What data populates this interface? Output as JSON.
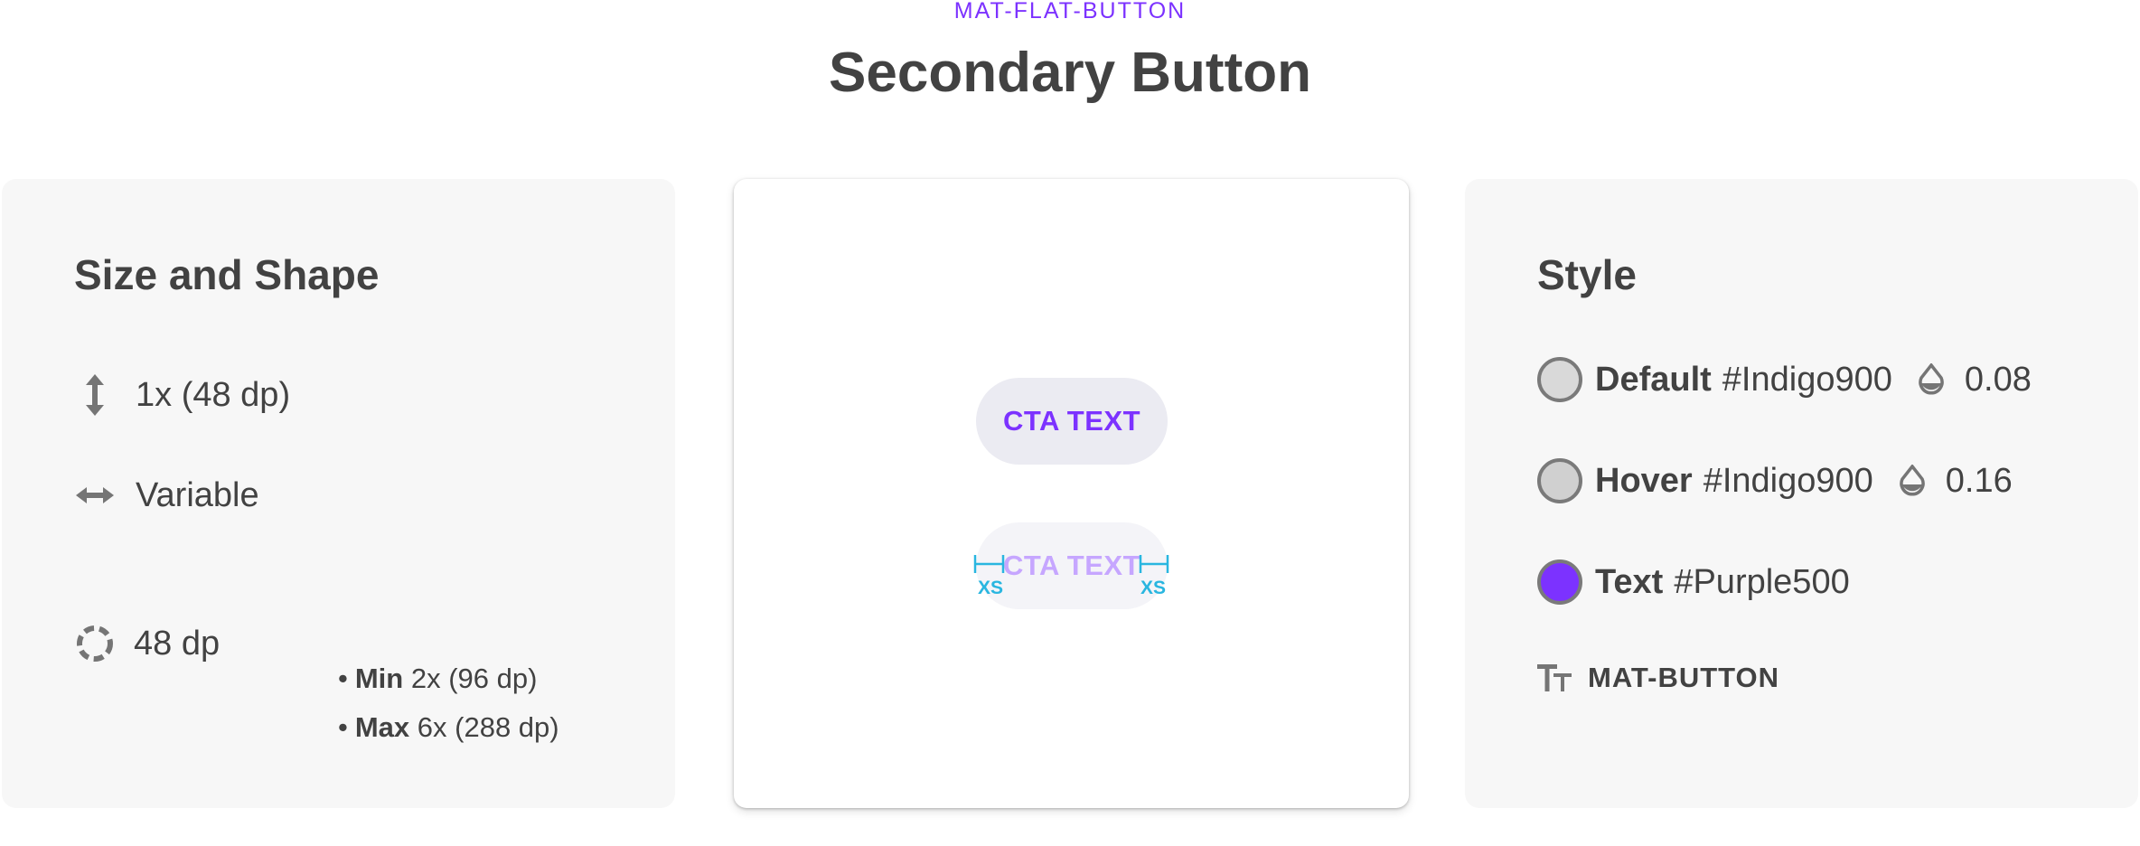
{
  "header": {
    "overline": "MAT-FLAT-BUTTON",
    "title": "Secondary Button"
  },
  "size_shape": {
    "title": "Size and Shape",
    "height_value": "1x (48 dp)",
    "width_value": "Variable",
    "min_label": "Min",
    "min_value": "2x (96 dp)",
    "max_label": "Max",
    "max_value": "6x (288 dp)",
    "radius_value": "48 dp",
    "icons": {
      "height": "vertical-arrows-icon",
      "width": "horizontal-arrows-icon",
      "radius": "dashed-circle-icon"
    }
  },
  "preview": {
    "button_label": "CTA TEXT",
    "ghost_label": "CTA TEXT",
    "padding_left_label": "XS",
    "padding_right_label": "XS"
  },
  "style": {
    "title": "Style",
    "default": {
      "label": "Default",
      "color": "#Indigo900",
      "opacity": "0.08",
      "swatch_hex": "#d9d9d9"
    },
    "hover": {
      "label": "Hover",
      "color": "#Indigo900",
      "opacity": "0.16",
      "swatch_hex": "#d0d0d0"
    },
    "text": {
      "label": "Text",
      "color": "#Purple500",
      "swatch_hex": "#7c32ff"
    },
    "typography": "MAT-BUTTON",
    "icons": {
      "opacity": "opacity-drop-icon",
      "typography": "text-size-icon"
    }
  },
  "colors": {
    "accent": "#7c32ff",
    "accent_light": "#c6a6ff",
    "spacing_marker": "#29b6e0",
    "text": "#424242",
    "card_bg": "#f7f7f7"
  }
}
